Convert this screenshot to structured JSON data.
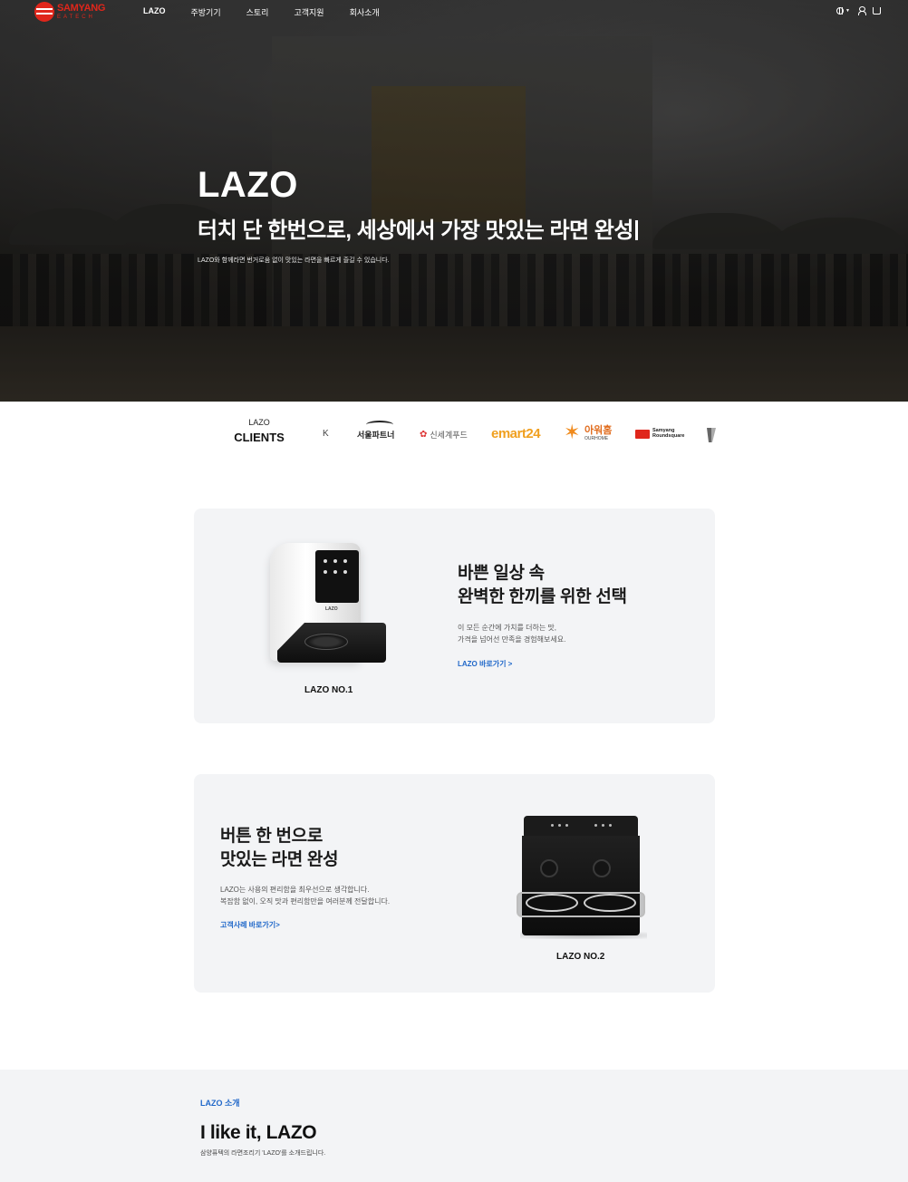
{
  "nav": {
    "logo_name": "SAMYANG",
    "logo_sub": "EATECH",
    "menu": [
      "LAZO",
      "주방기기",
      "스토리",
      "고객지원",
      "회사소개"
    ],
    "icons": [
      "globe-icon",
      "user-icon",
      "cart-icon"
    ]
  },
  "hero": {
    "title": "LAZO",
    "subtitle": "터치 단 한번으로, 세상에서 가장 맛있는 라면 완성",
    "description": "LAZO와 함께라면 번거로움 없이 맛있는 라면을 빠르게 즐길 수 있습니다."
  },
  "clients": {
    "label_small": "LAZO",
    "label_big": "CLIENTS",
    "logos": {
      "k": "K",
      "seoul": "서울파트너",
      "shinsegae": "신세계푸드",
      "emart": "emart24",
      "ourhome_kr": "아워홈",
      "ourhome_en": "OURHOME",
      "samyang_1": "Samyang",
      "samyang_2": "Roundsquare"
    }
  },
  "card1": {
    "title_line1": "바쁜 일상 속",
    "title_line2": "완벽한 한끼를 위한 선택",
    "desc_line1": "이 모든 순간에 가치를 더하는 맛,",
    "desc_line2": "가격을 넘어선 만족을 경험해보세요.",
    "link": "LAZO 바로가기 >",
    "caption": "LAZO NO.1",
    "device_logo": "LAZO"
  },
  "card2": {
    "title_line1": "버튼 한 번으로",
    "title_line2": "맛있는 라면 완성",
    "desc_line1": "LAZO는 사용의 편리함을 최우선으로 생각합니다.",
    "desc_line2": "복잡함 없이, 오직 맛과 편리함만을 여러분께 전달합니다.",
    "link": "고객사례 바로가기>",
    "caption": "LAZO NO.2"
  },
  "intro": {
    "eyebrow": "LAZO 소개",
    "title": "I like it, LAZO",
    "description": "삼양퓨텍의 라면조리기 'LAZO'를 소개드립니다."
  },
  "colors": {
    "brand_red": "#e0261b",
    "link_blue": "#2168c9",
    "card_bg": "#f3f4f6"
  }
}
